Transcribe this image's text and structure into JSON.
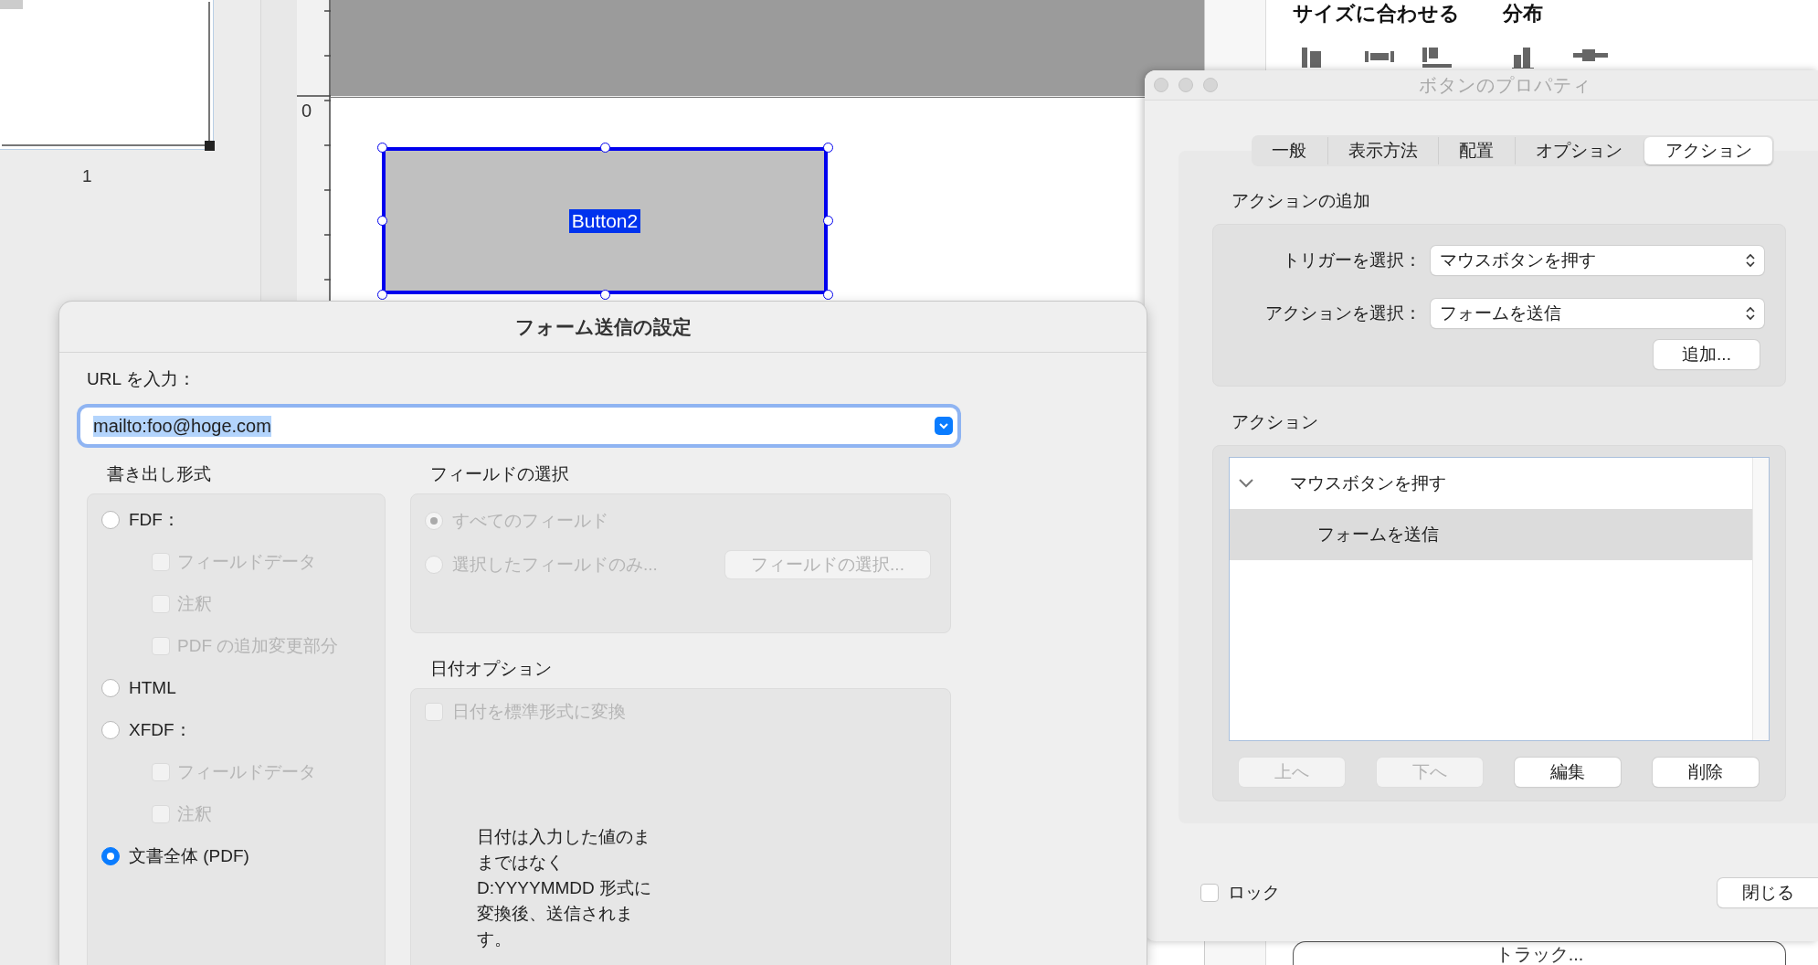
{
  "background": {
    "thumbnail_label": "1",
    "ruler_zero": "0",
    "form_field": {
      "label": "Button2",
      "selected": true
    },
    "toolbar_labels": [
      "サイズに合わせる",
      "分布"
    ],
    "bottom_button": "トラック..."
  },
  "properties_window": {
    "title": "ボタンのプロパティ",
    "tabs": [
      {
        "label": "一般",
        "selected": false
      },
      {
        "label": "表示方法",
        "selected": false
      },
      {
        "label": "配置",
        "selected": false
      },
      {
        "label": "オプション",
        "selected": false
      },
      {
        "label": "アクション",
        "selected": true
      }
    ],
    "add_section": {
      "heading": "アクションの追加",
      "trigger_label": "トリガーを選択：",
      "trigger_value": "マウスボタンを押す",
      "action_label": "アクションを選択：",
      "action_value": "フォームを送信",
      "add_button": "追加..."
    },
    "actions_section": {
      "heading": "アクション",
      "tree": [
        {
          "label": "マウスボタンを押す",
          "expanded": true,
          "selected": false,
          "children": [
            {
              "label": "フォームを送信",
              "selected": true
            }
          ]
        }
      ],
      "buttons": [
        {
          "label": "上へ",
          "disabled": true
        },
        {
          "label": "下へ",
          "disabled": true
        },
        {
          "label": "編集",
          "disabled": false
        },
        {
          "label": "削除",
          "disabled": false
        }
      ]
    },
    "lock": {
      "label": "ロック",
      "checked": false
    },
    "close_button": "閉じる"
  },
  "submit_sheet": {
    "title": "フォーム送信の設定",
    "url_label": "URL を入力：",
    "url_value": "mailto:foo@hoge.com",
    "export_format": {
      "heading": "書き出し形式",
      "options": [
        {
          "label": "FDF：",
          "selected": false,
          "children": [
            {
              "label": "フィールドデータ",
              "checked": false,
              "disabled": true
            },
            {
              "label": "注釈",
              "checked": false,
              "disabled": true
            },
            {
              "label": "PDF の追加変更部分",
              "checked": false,
              "disabled": true
            }
          ]
        },
        {
          "label": "HTML",
          "selected": false
        },
        {
          "label": "XFDF：",
          "selected": false,
          "children": [
            {
              "label": "フィールドデータ",
              "checked": false,
              "disabled": true
            },
            {
              "label": "注釈",
              "checked": false,
              "disabled": true
            }
          ]
        },
        {
          "label": "文書全体 (PDF)",
          "selected": true
        }
      ]
    },
    "field_selection": {
      "heading": "フィールドの選択",
      "options": [
        {
          "label": "すべてのフィールド",
          "selected": true,
          "disabled": true
        },
        {
          "label": "選択したフィールドのみ...",
          "selected": false,
          "disabled": true
        }
      ],
      "button": {
        "label": "フィールドの選択...",
        "disabled": true
      }
    },
    "date_options": {
      "heading": "日付オプション",
      "checkbox": {
        "label": "日付を標準形式に変換",
        "checked": false,
        "disabled": true
      },
      "note": "日付は入力した値のままではなくD:YYYYMMDD 形式に変換後、送信されます。"
    }
  }
}
